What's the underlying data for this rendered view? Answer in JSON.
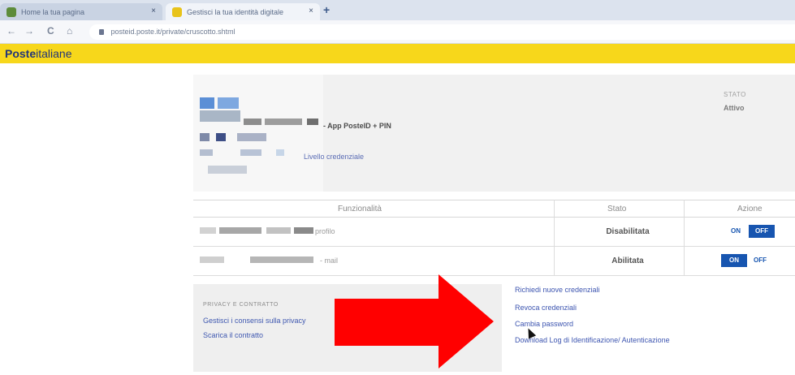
{
  "browser": {
    "tabs": [
      {
        "label": "Home la tua pagina"
      },
      {
        "label": "Gestisci la tua identità digitale"
      }
    ],
    "new_tab_glyph": "+",
    "close_glyph": "×",
    "url": "posteid.poste.it/private/cruscotto.shtml",
    "nav": {
      "back": "←",
      "forward": "→",
      "reload": "C",
      "home": "⌂"
    }
  },
  "header": {
    "logo_bold": "Poste",
    "logo_rest": "italiane",
    "brand_color": "#f7d71b"
  },
  "identity": {
    "service_label": "- App PosteID + PIN",
    "cred_link": "Livello credenziale",
    "stato_label": "STATO",
    "stato_value": "Attivo"
  },
  "table": {
    "headers": {
      "feature": "Funzionalità",
      "state": "Stato",
      "action": "Azione"
    },
    "rows": [
      {
        "text": "profilo",
        "state": "Disabilitata",
        "on": "ON",
        "off": "OFF",
        "active": "off"
      },
      {
        "text": "- mail",
        "state": "Abilitata",
        "on": "ON",
        "off": "OFF",
        "active": "on"
      }
    ]
  },
  "privacy": {
    "title": "PRIVACY E CONTRATTO",
    "link1": "Gestisci i consensi sulla privacy",
    "link2": "Scarica il contratto"
  },
  "actions": [
    "Richiedi nuove credenziali",
    "Revoca credenziali",
    "Cambia password",
    "Download Log di Identificazione/ Autenticazione"
  ],
  "accent_color": "#1755b0",
  "overlay_color": "#ff0000"
}
